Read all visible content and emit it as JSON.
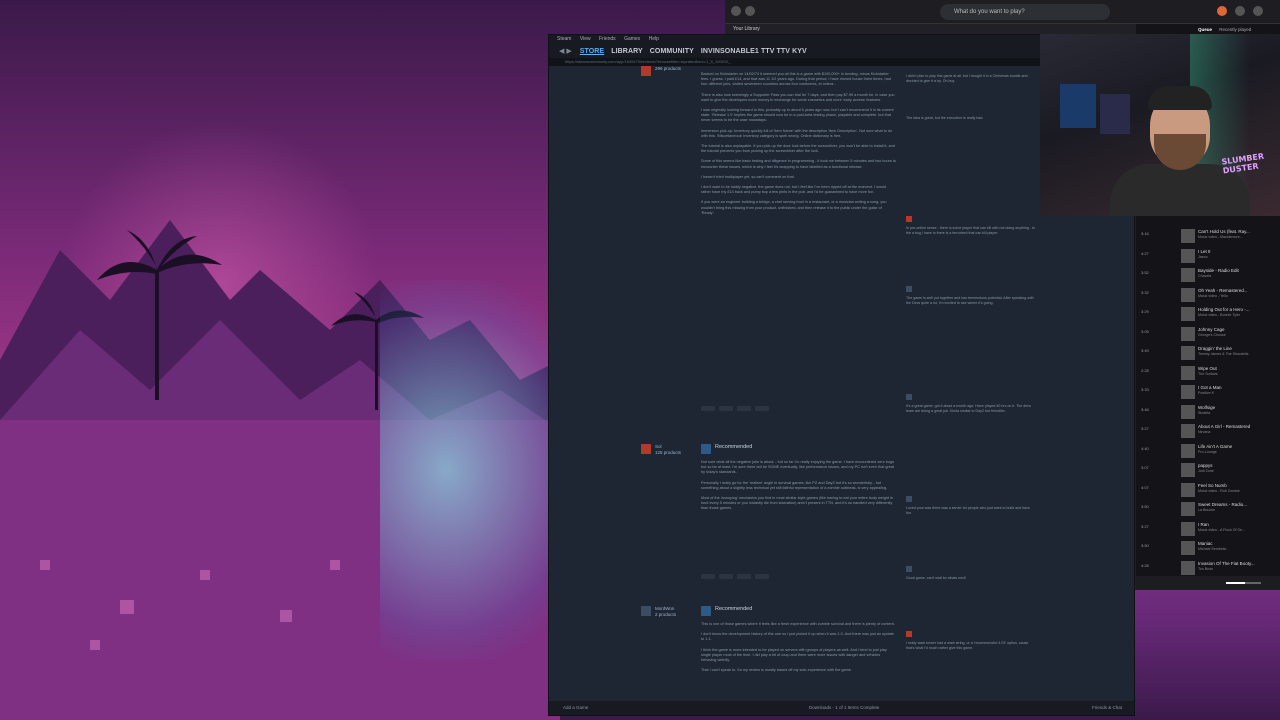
{
  "browser": {
    "search_placeholder": "What do you want to play?",
    "tab_label": "Your Library"
  },
  "steam": {
    "menu": [
      "Steam",
      "View",
      "Friends",
      "Games",
      "Help"
    ],
    "nav": [
      "STORE",
      "LIBRARY",
      "COMMUNITY",
      "INVINSONABLE1 TTV TTV KYV"
    ],
    "active_nav": "STORE",
    "url": "https://steamcommunity.com/app/1649470/reviews/?browsefilter=toprated&snr=1_5_100010_",
    "footer": {
      "add_game": "Add a Game",
      "downloads": "Downloads - 1 of 1 Items Complete",
      "friends_chat": "Friends & Chat"
    },
    "reviews": [
      {
        "user": "",
        "games": "296 products",
        "recommended": "",
        "paragraphs": [
          "Backed on Kickstarter on 14/02/74 it seemed you all this is a game with $100,000+ in funding, minus Kickstarter fees. I guess. I paid £14, and that was 11 1/2 years ago. During that period, I have moved house three times, had four different jobs, visited seventeen countries across four continents, et cetera...",
          "There is also now seemingly a Supporter Pass you can trial for 7 days, and then pay $7.99 a month for, in case you want to give the developers more money in exchange for some cosmetics and more 'early access' features.",
          "I was originally looking forward to this, probably up to about 6 years ago now, but I can't recommend it in its current state. 'Release 1.0' implies the game should now be in a post-beta testing phase, playable and complete, but that never seems to be the case nowadays.",
          "Immersion pick-up: Inventory quickly full of 'Item Name' with the description 'Item Description'. Not sure what to do with this. 'Miscellaneous' inventory category is spell wrong. Online dictionary is free.",
          "The tutorial is also unplayable. If you pick up the door lock before the screwdriver, you won't be able to install it, and the tutorial prevents you from picking up the screwdriver after the lock.",
          "Some of this seems like basic testing and diligence in programming - it took me between 5 minutes and two hours to encounter these issues, which is why I feel it's wrapping to have labelled as a functional release.",
          "I haven't tried multiplayer yet, so can't comment on that.",
          "I don't want to be totally negative, the game does run, but I feel like I've been ripped off at the moment. I would rather have my £14 back and pump buy a few pints in the pub, and I'd be guaranteed to have more fun.",
          "If you were an engineer building a bridge, a chef serving food in a restaurant, or a musician writing a song, you wouldn't bring this missing from your product, unfinished, and then release it to the public under the guise of 'Ready'."
        ]
      },
      {
        "user": "Sol",
        "games": "125 products",
        "recommended": "Recommended",
        "paragraphs": [
          "Not sure what all the negative joke is about... but so far I'm really enjoying the game. I have encountered zero bugs but so far at least. I'm sure there will be SOME eventually, like performance issues, and my PC isn't even that great by today's standards.",
          "Personally I really go for the 'realism' angle in survival games, like PZ and DayZ but it's so wonderfully... but something about a slightly less technical yet still faithful representation of a zombie outbreak, is very appealing.",
          "Most of the 'annoying' mechanics you find in most similar style games (like having to eat your entire body weight in food every 5 minutes or you instantly die from starvation) aren't present in TTN, and it's so handled very differently than those games."
        ]
      },
      {
        "user": "MordWon",
        "games": "2 products",
        "recommended": "Recommended",
        "paragraphs": [
          "This is one of those games where it feels like a fresh experience with zombie survival and there is plenty of content.",
          "I don't know the development history of this one so I just picked it up when it was 1.0. And there was just an update to 1.1.",
          "I think the game is more intended to be played on servers with groups of players as well. And I tend to just play single player most of the time. I did play a bit of coop and there were more issues with danger and vehicles behaving weirdly.",
          "That I can't speak to. So my review is mostly based off my solo experience with the game."
        ]
      }
    ],
    "comments": [
      "I didn't plan to play this game at all, but I bought it in a Christmas bundle and decided to give it a try. Oh boy.",
      "The idea is great, but the execution is really bad.",
      "In pre-online sense - there is some player that can kill with not doing anything - to the a bug I have in there is a terrorized that can kill player.",
      "The game is well put together and has tremendous potential. After speaking with the Devs quite a lot, I'm excited to see where it's going.",
      "It's a great game, got it about a month ago. Have played 40 hrs on it. The devs team are doing a great job. Kinda similar to DayZ but friendlier.",
      "Loved your was there was a server for people who just want to build and have fun.",
      "Good game, can't wait for whats next!",
      "I really want newer had a main string, or a 'recommended 4.03' option, cause that's what I'd much rather give this game."
    ]
  },
  "webcam": {
    "sign_text": "SLUMBER DUSTER"
  },
  "music": {
    "header_active": "Queue",
    "header_other": "Recently played",
    "tracks": [
      {
        "dur": "3:16",
        "title": "Can't Hold Us (feat. Ray...",
        "artist": "Music video - Macklemore..."
      },
      {
        "dur": "4:27",
        "title": "I Let It",
        "artist": "Jaeco"
      },
      {
        "dur": "3:52",
        "title": "Bayside - Radio Edit",
        "artist": "Chavela"
      },
      {
        "dur": "3:32",
        "title": "Oh Yeah - Remastered...",
        "artist": "Music video - Yello"
      },
      {
        "dur": "3:29",
        "title": "Holding Out for a Hero -...",
        "artist": "Music video - Bonnie Tyler"
      },
      {
        "dur": "3:05",
        "title": "Johnny Cage",
        "artist": "George's Choose"
      },
      {
        "dur": "3:49",
        "title": "Draggin' the Line",
        "artist": "Tommy James & The Shondells"
      },
      {
        "dur": "2:28",
        "title": "Wipe Out",
        "artist": "The Surfaris"
      },
      {
        "dur": "3:33",
        "title": "I Got a Man",
        "artist": "Positive K"
      },
      {
        "dur": "3:46",
        "title": "Wolfsige",
        "artist": "Sinatria"
      },
      {
        "dur": "3:27",
        "title": "About A Girl - Remastered",
        "artist": "Nirvana"
      },
      {
        "dur": "4:40",
        "title": "Life Ain't A Game",
        "artist": "Pro-Lounge"
      },
      {
        "dur": "3:07",
        "title": "pappys",
        "artist": "Jodi Zone"
      },
      {
        "dur": "4:07",
        "title": "Feel So Numb",
        "artist": "Music video - Rob Zombie"
      },
      {
        "dur": "3:50",
        "title": "Sweet Dreams - Radio...",
        "artist": "La Bouche"
      },
      {
        "dur": "3:27",
        "title": "I Ran",
        "artist": "Music video - A Flock Of Se..."
      },
      {
        "dur": "3:50",
        "title": "Maniac",
        "artist": "Michael Sembello"
      },
      {
        "dur": "4:28",
        "title": "Invasion Of The Fiat Booty...",
        "artist": "Ton Bruin"
      }
    ],
    "progress": 0.55
  }
}
